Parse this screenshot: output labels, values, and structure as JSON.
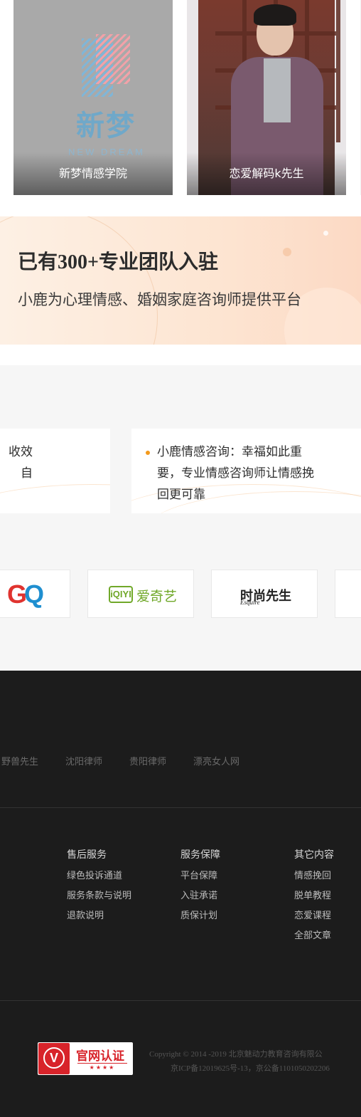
{
  "cards": [
    {
      "caption": "新梦情感学院",
      "logo_text": "新梦",
      "logo_sub": "NEW DREAM"
    },
    {
      "caption": "恋爱解码k先生"
    }
  ],
  "banner": {
    "title": "已有300+专业团队入驻",
    "subtitle": "小鹿为心理情感、婚姻家庭咨询师提供平台"
  },
  "quotes": {
    "left_line1": "收效",
    "left_line2": "自",
    "right_line1": "小鹿情感咨询：幸福如此重",
    "right_line2": "要，专业情感咨询师让情感挽",
    "right_line3": "回更可靠"
  },
  "media_logos": {
    "gq": "GQ",
    "iqiyi_mark": "iQIYI",
    "iqiyi_label": "爱奇艺",
    "esquire_label": "时尚先生",
    "esquire_script": "Esquire"
  },
  "footer": {
    "links": [
      "野兽先生",
      "沈阳律师",
      "贵阳律师",
      "漂亮女人网"
    ],
    "columns": [
      {
        "title": "售后服务",
        "items": [
          "绿色投诉通道",
          "服务条款与说明",
          "退款说明"
        ]
      },
      {
        "title": "服务保障",
        "items": [
          "平台保障",
          "入驻承诺",
          "质保计划"
        ]
      },
      {
        "title": "其它内容",
        "items": [
          "情感挽回",
          "脱单教程",
          "恋爱课程",
          "全部文章"
        ]
      }
    ],
    "badge": {
      "mark": "V",
      "title": "官网认证",
      "stars": "★★★★"
    },
    "copyright": "Copyright © 2014 -2019 北京魅动力教育咨询有限公",
    "icp": "京ICP备12019625号-13，京公备1101050202206"
  },
  "colors": {
    "accent": "#f39a1c",
    "badge_red": "#d8232a",
    "iqiyi_green": "#70a829",
    "footer_bg": "#1c1c1c"
  }
}
